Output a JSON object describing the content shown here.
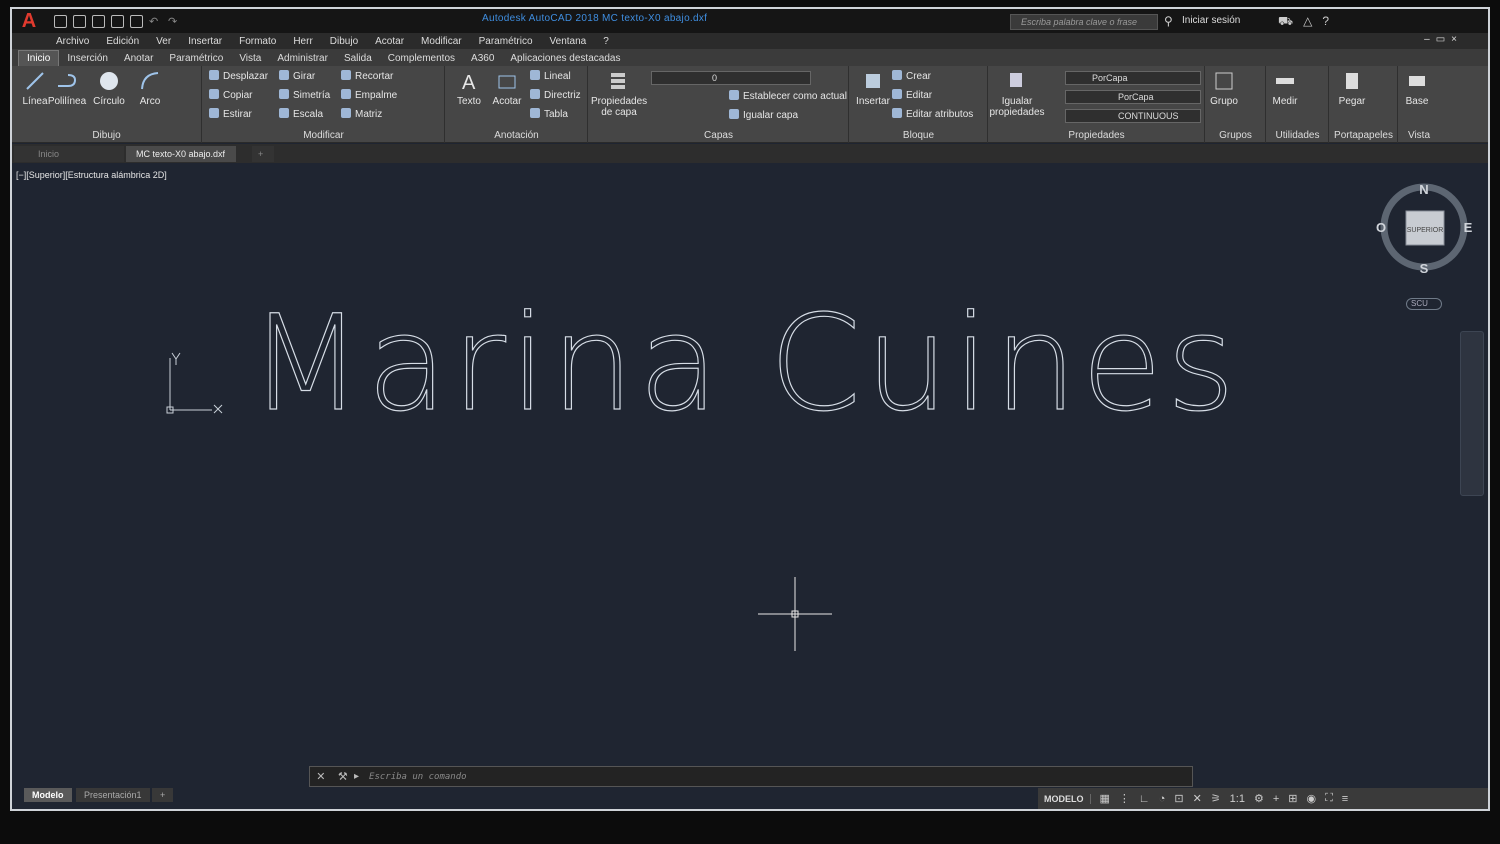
{
  "window": {
    "app_logo": "A",
    "title": "Autodesk AutoCAD 2018    MC texto-X0 abajo.dxf",
    "search_placeholder": "Escriba palabra clave o frase",
    "signin_label": "Iniciar sesión"
  },
  "menu": [
    "Archivo",
    "Edición",
    "Ver",
    "Insertar",
    "Formato",
    "Herr",
    "Dibujo",
    "Acotar",
    "Modificar",
    "Paramétrico",
    "Ventana",
    "?"
  ],
  "ribbon_tabs": [
    "Inicio",
    "Inserción",
    "Anotar",
    "Paramétrico",
    "Vista",
    "Administrar",
    "Salida",
    "Complementos",
    "A360",
    "Aplicaciones destacadas"
  ],
  "ribbon": {
    "dibujo": {
      "name": "Dibujo",
      "linea": "Línea",
      "polilinea": "Polilínea",
      "circulo": "Círculo",
      "arco": "Arco"
    },
    "modificar": {
      "name": "Modificar",
      "desplazar": "Desplazar",
      "girar": "Girar",
      "recortar": "Recortar",
      "copiar": "Copiar",
      "simetria": "Simetría",
      "empalme": "Empalme",
      "estirar": "Estirar",
      "escala": "Escala",
      "matriz": "Matriz"
    },
    "anotacion": {
      "name": "Anotación",
      "texto": "Texto",
      "acotar": "Acotar",
      "lineal": "Lineal",
      "directriz": "Directriz",
      "tabla": "Tabla"
    },
    "capas": {
      "name": "Capas",
      "propiedades": "Propiedades de capa",
      "layer_value": "0",
      "establecer": "Establecer como actual",
      "igualar": "Igualar capa"
    },
    "bloque": {
      "name": "Bloque",
      "insertar": "Insertar",
      "crear": "Crear",
      "editar": "Editar",
      "editar_atributos": "Editar atributos"
    },
    "propiedades": {
      "name": "Propiedades",
      "igualar": "Igualar propiedades",
      "color": "PorCapa",
      "linetype": "PorCapa",
      "lineweight": "CONTINUOUS"
    },
    "grupos": {
      "name": "Grupos",
      "grupo": "Grupo"
    },
    "utilidades": {
      "name": "Utilidades",
      "medir": "Medir"
    },
    "portapapeles": {
      "name": "Portapapeles",
      "pegar": "Pegar"
    },
    "vista": {
      "name": "Vista",
      "base": "Base"
    }
  },
  "doc_tabs": {
    "home": "Inicio",
    "active": "MC texto-X0 abajo.dxf"
  },
  "viewport_label": "[−][Superior][Estructura alámbrica 2D]",
  "drawing_text": "Marina Cuines",
  "viewcube": {
    "n": "N",
    "s": "S",
    "e": "E",
    "o": "O",
    "face": "SUPERIOR",
    "ucs": "SCU"
  },
  "command_placeholder": "Escriba un comando",
  "layout_tabs": {
    "model": "Modelo",
    "layout1": "Presentación1"
  },
  "status": {
    "model": "MODELO",
    "scale": "1:1"
  }
}
